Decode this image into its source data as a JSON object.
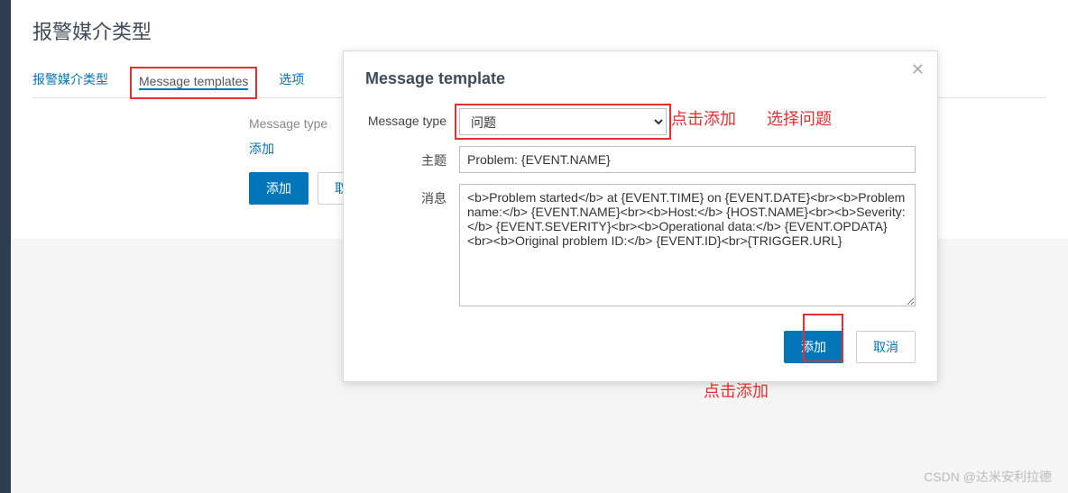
{
  "page": {
    "title": "报警媒介类型"
  },
  "tabs": {
    "t0": "报警媒介类型",
    "t1": "Message templates",
    "t2": "选项"
  },
  "form": {
    "label_message_type": "Message type",
    "link_add": "添加",
    "btn_add": "添加",
    "btn_cancel": "取消"
  },
  "modal": {
    "title": "Message template",
    "label_message_type": "Message type",
    "select_value": "问题",
    "label_subject": "主题",
    "subject_value": "Problem: {EVENT.NAME}",
    "label_message": "消息",
    "message_value": "<b>Problem started</b> at {EVENT.TIME} on {EVENT.DATE}<br><b>Problem name:</b> {EVENT.NAME}<br><b>Host:</b> {HOST.NAME}<br><b>Severity:</b> {EVENT.SEVERITY}<br><b>Operational data:</b> {EVENT.OPDATA}<br><b>Original problem ID:</b> {EVENT.ID}<br>{TRIGGER.URL}",
    "btn_add": "添加",
    "btn_cancel": "取消"
  },
  "annotations": {
    "click_add_top": "点击添加",
    "choose_problem": "选择问题",
    "click_add_bottom": "点击添加"
  },
  "watermark": "CSDN @达米安利拉德"
}
